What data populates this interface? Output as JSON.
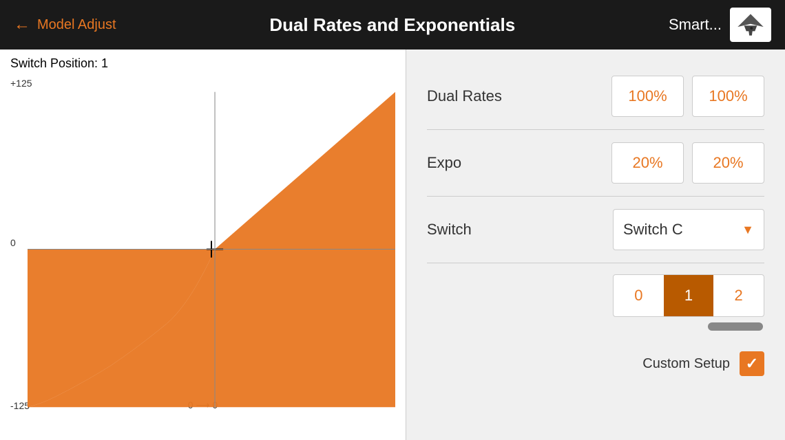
{
  "header": {
    "back_label": "Model Adjust",
    "title": "Dual Rates and Exponentials",
    "model_name": "Smart...",
    "back_arrow": "←"
  },
  "graph": {
    "switch_position_label": "Switch Position: 1",
    "y_top": "+125",
    "y_zero": "0",
    "y_bottom": "-125",
    "x_label": "0 ⟶ 0"
  },
  "params": {
    "dual_rates_label": "Dual Rates",
    "dual_rates_val1": "100%",
    "dual_rates_val2": "100%",
    "expo_label": "Expo",
    "expo_val1": "20%",
    "expo_val2": "20%",
    "switch_label": "Switch",
    "switch_value": "Switch C",
    "switch_dropdown_arrow": "▼"
  },
  "positions": {
    "items": [
      {
        "label": "0",
        "active": false
      },
      {
        "label": "1",
        "active": true
      },
      {
        "label": "2",
        "active": false
      }
    ]
  },
  "custom_setup": {
    "label": "Custom Setup",
    "checkmark": "✓"
  }
}
